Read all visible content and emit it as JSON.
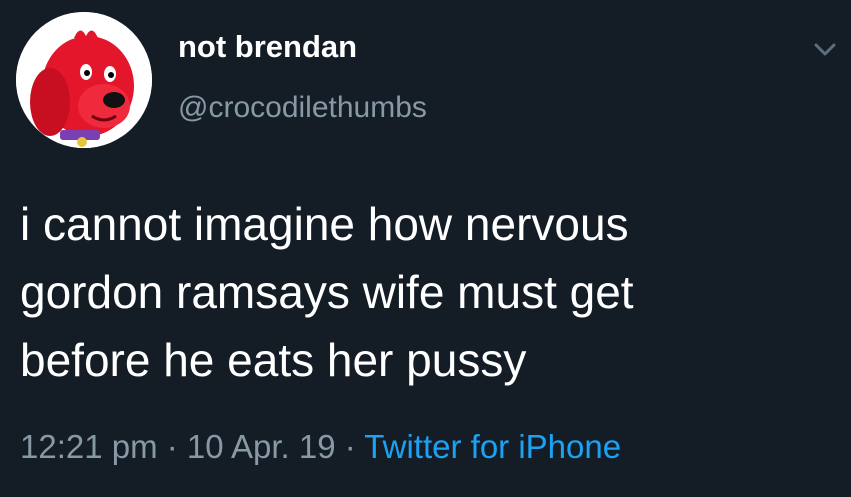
{
  "colors": {
    "background": "#141d26",
    "text_primary": "#ffffff",
    "text_secondary": "#8899a6",
    "link": "#1da1f2"
  },
  "tweet": {
    "avatar_icon": "clifford-red-dog-avatar",
    "display_name": "not brendan",
    "handle": "@crocodilethumbs",
    "caret_icon": "chevron-down-icon",
    "text_lines": [
      "i cannot imagine how nervous",
      "gordon ramsays wife must get",
      "before he eats her pussy"
    ],
    "time": "12:21 pm",
    "separator": " · ",
    "date": "10 Apr. 19",
    "source": "Twitter for iPhone"
  }
}
